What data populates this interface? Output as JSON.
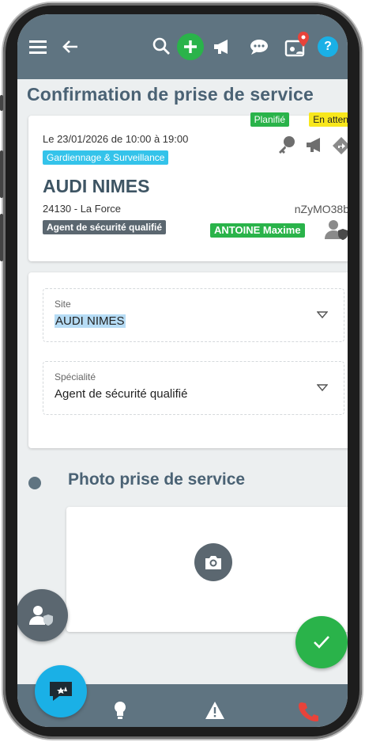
{
  "colors": {
    "bar": "#5f7481",
    "accent_green": "#2ab34a",
    "accent_blue": "#1ab0e6",
    "badge_cyan": "#34c3ea",
    "badge_yellow": "#f8e71c",
    "badge_dark": "#5b6770",
    "fab_gray": "#5b6770",
    "call_red": "#e8433a"
  },
  "topbar": {
    "icons": [
      "menu-icon",
      "back-arrow-icon",
      "search-icon",
      "add-icon",
      "megaphone-icon",
      "chat-icon",
      "presence-icon",
      "help-icon"
    ]
  },
  "page_title": "Confirmation de prise de service",
  "mission": {
    "status_planned": "Planifié",
    "status_waiting": "En attente",
    "date_line": "Le 23/01/2026 de 10:00 à 19:00",
    "category": "Gardiennage & Surveillance",
    "client": "AUDI NIMES",
    "location": "24130 - La Force",
    "reference": "nZyMO38b",
    "role": "Agent de sécurité qualifié",
    "agent": "ANTOINE Maxime",
    "actions": [
      "key-icon",
      "megaphone-icon",
      "share-icon"
    ]
  },
  "form": {
    "site": {
      "label": "Site",
      "value": "AUDI NIMES"
    },
    "specialty": {
      "label": "Spécialité",
      "value": "Agent de sécurité qualifié"
    }
  },
  "photo_section": {
    "title": "Photo prise de service"
  },
  "bottombar": {
    "icons": [
      "message-icon",
      "lightbulb-icon",
      "warning-icon",
      "phone-icon"
    ]
  }
}
